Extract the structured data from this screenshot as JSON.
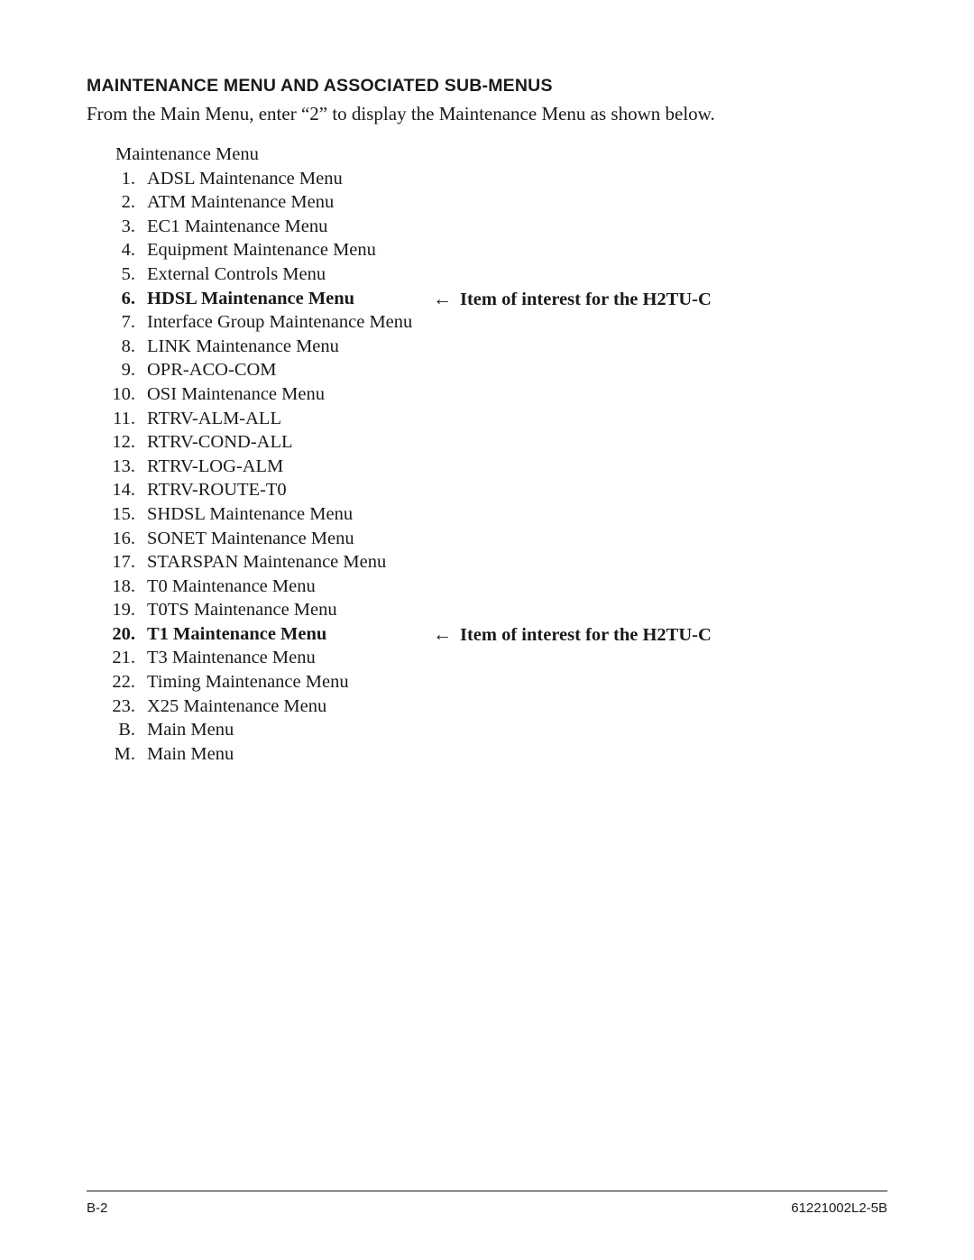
{
  "document": {
    "section_title": "MAINTENANCE MENU AND ASSOCIATED SUB-MENUS",
    "intro_paragraph": "From the Main Menu, enter “2” to display the Maintenance Menu as shown below.",
    "menu_heading": "Maintenance Menu"
  },
  "menu_items": [
    {
      "number": "1.",
      "label": "ADSL Maintenance Menu",
      "bold": false,
      "note": ""
    },
    {
      "number": "2.",
      "label": "ATM Maintenance Menu",
      "bold": false,
      "note": ""
    },
    {
      "number": "3.",
      "label": "EC1 Maintenance Menu",
      "bold": false,
      "note": ""
    },
    {
      "number": "4.",
      "label": "Equipment Maintenance Menu",
      "bold": false,
      "note": ""
    },
    {
      "number": "5.",
      "label": "External Controls Menu",
      "bold": false,
      "note": ""
    },
    {
      "number": "6.",
      "label": "HDSL Maintenance Menu",
      "bold": true,
      "note": "Item of interest for the H2TU-C"
    },
    {
      "number": "7.",
      "label": "Interface Group Maintenance Menu",
      "bold": false,
      "note": ""
    },
    {
      "number": "8.",
      "label": "LINK Maintenance Menu",
      "bold": false,
      "note": ""
    },
    {
      "number": "9.",
      "label": "OPR-ACO-COM",
      "bold": false,
      "note": ""
    },
    {
      "number": "10.",
      "label": "OSI Maintenance Menu",
      "bold": false,
      "note": ""
    },
    {
      "number": "11.",
      "label": "RTRV-ALM-ALL",
      "bold": false,
      "note": ""
    },
    {
      "number": "12.",
      "label": "RTRV-COND-ALL",
      "bold": false,
      "note": ""
    },
    {
      "number": "13.",
      "label": "RTRV-LOG-ALM",
      "bold": false,
      "note": ""
    },
    {
      "number": "14.",
      "label": "RTRV-ROUTE-T0",
      "bold": false,
      "note": ""
    },
    {
      "number": "15.",
      "label": "SHDSL Maintenance Menu",
      "bold": false,
      "note": ""
    },
    {
      "number": "16.",
      "label": "SONET Maintenance Menu",
      "bold": false,
      "note": ""
    },
    {
      "number": "17.",
      "label": "STARSPAN Maintenance Menu",
      "bold": false,
      "note": ""
    },
    {
      "number": "18.",
      "label": "T0 Maintenance Menu",
      "bold": false,
      "note": ""
    },
    {
      "number": "19.",
      "label": "T0TS Maintenance Menu",
      "bold": false,
      "note": ""
    },
    {
      "number": "20.",
      "label": "T1 Maintenance Menu",
      "bold": true,
      "note": "Item of interest for the H2TU-C"
    },
    {
      "number": "21.",
      "label": "T3 Maintenance Menu",
      "bold": false,
      "note": ""
    },
    {
      "number": "22.",
      "label": "Timing Maintenance Menu",
      "bold": false,
      "note": ""
    },
    {
      "number": "23.",
      "label": "X25 Maintenance Menu",
      "bold": false,
      "note": ""
    },
    {
      "number": "B.",
      "label": "Main Menu",
      "bold": false,
      "note": ""
    },
    {
      "number": "M.",
      "label": "Main Menu",
      "bold": false,
      "note": ""
    }
  ],
  "icons": {
    "note_arrow": "←"
  },
  "footer": {
    "page_number": "B-2",
    "document_number": "61221002L2-5B"
  }
}
